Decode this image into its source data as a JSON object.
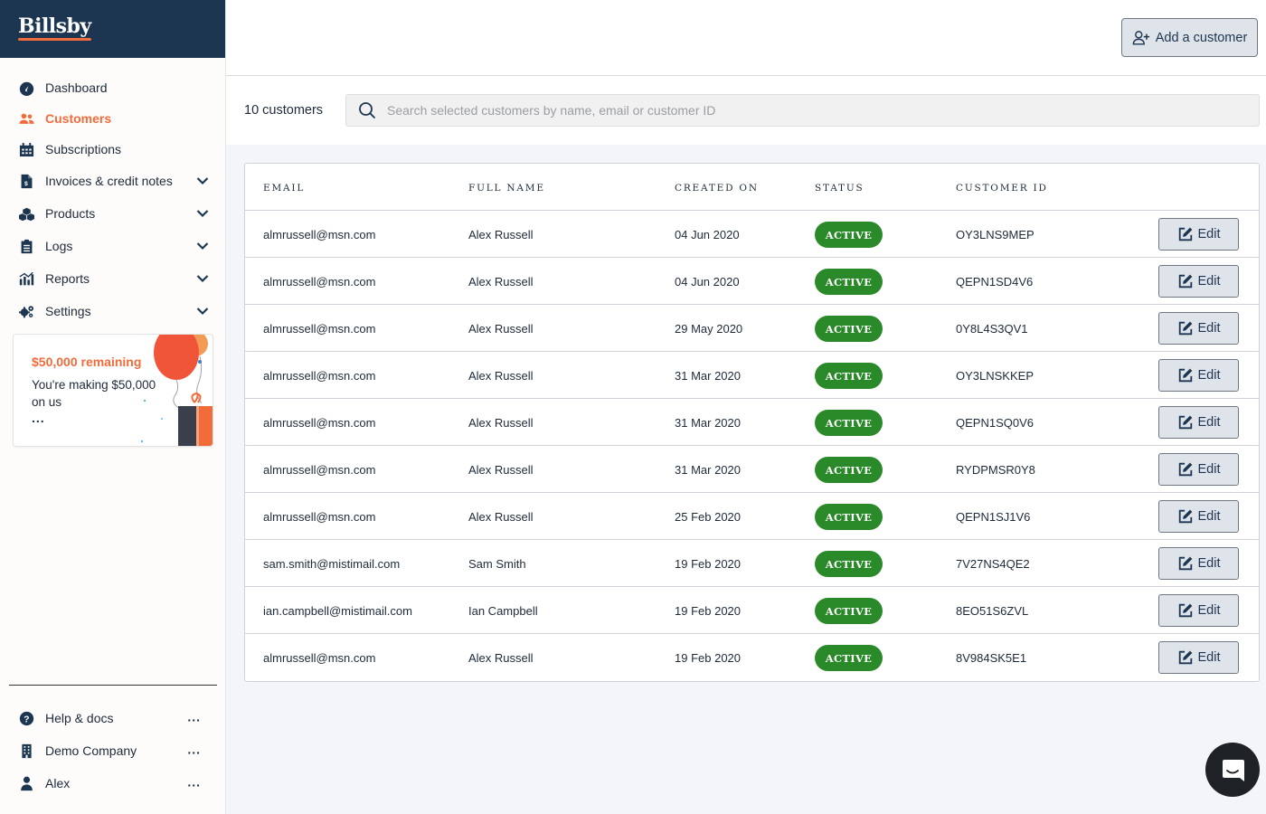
{
  "brand": {
    "name": "Billsby"
  },
  "sidebar": {
    "items": [
      {
        "label": "Dashboard",
        "icon": "dashboard-gauge-icon",
        "has_chevron": false,
        "active": false
      },
      {
        "label": "Customers",
        "icon": "users-icon",
        "has_chevron": false,
        "active": true
      },
      {
        "label": "Subscriptions",
        "icon": "calendar-icon",
        "has_chevron": false,
        "active": false
      },
      {
        "label": "Invoices & credit notes",
        "icon": "invoice-icon",
        "has_chevron": true,
        "active": false
      },
      {
        "label": "Products",
        "icon": "boxes-icon",
        "has_chevron": true,
        "active": false
      },
      {
        "label": "Logs",
        "icon": "clipboard-icon",
        "has_chevron": true,
        "active": false
      },
      {
        "label": "Reports",
        "icon": "chart-icon",
        "has_chevron": true,
        "active": false
      },
      {
        "label": "Settings",
        "icon": "gears-icon",
        "has_chevron": true,
        "active": false
      }
    ],
    "promo": {
      "title": "$50,000 remaining",
      "text": "You're making $50,000 on us",
      "more": "..."
    },
    "bottom": [
      {
        "label": "Help & docs",
        "icon": "question-circle-icon",
        "more": "..."
      },
      {
        "label": "Demo Company",
        "icon": "building-icon",
        "more": "..."
      },
      {
        "label": "Alex",
        "icon": "user-icon",
        "more": "..."
      }
    ]
  },
  "header": {
    "add_button_label": "Add a customer"
  },
  "search": {
    "count_label": "10 customers",
    "placeholder": "Search selected customers by name, email or customer ID"
  },
  "table": {
    "columns": [
      "EMAIL",
      "FULL NAME",
      "CREATED ON",
      "STATUS",
      "CUSTOMER ID"
    ],
    "edit_label": "Edit",
    "rows": [
      {
        "email": "almrussell@msn.com",
        "name": "Alex Russell",
        "created": "04 Jun 2020",
        "status": "ACTIVE",
        "id": "OY3LNS9MEP"
      },
      {
        "email": "almrussell@msn.com",
        "name": "Alex Russell",
        "created": "04 Jun 2020",
        "status": "ACTIVE",
        "id": "QEPN1SD4V6"
      },
      {
        "email": "almrussell@msn.com",
        "name": "Alex Russell",
        "created": "29 May 2020",
        "status": "ACTIVE",
        "id": "0Y8L4S3QV1"
      },
      {
        "email": "almrussell@msn.com",
        "name": "Alex Russell",
        "created": "31 Mar 2020",
        "status": "ACTIVE",
        "id": "OY3LNSKKEP"
      },
      {
        "email": "almrussell@msn.com",
        "name": "Alex Russell",
        "created": "31 Mar 2020",
        "status": "ACTIVE",
        "id": "QEPN1SQ0V6"
      },
      {
        "email": "almrussell@msn.com",
        "name": "Alex Russell",
        "created": "31 Mar 2020",
        "status": "ACTIVE",
        "id": "RYDPMSR0Y8"
      },
      {
        "email": "almrussell@msn.com",
        "name": "Alex Russell",
        "created": "25 Feb 2020",
        "status": "ACTIVE",
        "id": "QEPN1SJ1V6"
      },
      {
        "email": "sam.smith@mistimail.com",
        "name": "Sam Smith",
        "created": "19 Feb 2020",
        "status": "ACTIVE",
        "id": "7V27NS4QE2"
      },
      {
        "email": "ian.campbell@mistimail.com",
        "name": "Ian Campbell",
        "created": "19 Feb 2020",
        "status": "ACTIVE",
        "id": "8EO51S6ZVL"
      },
      {
        "email": "almrussell@msn.com",
        "name": "Alex Russell",
        "created": "19 Feb 2020",
        "status": "ACTIVE",
        "id": "8V984SK5E1"
      }
    ]
  },
  "colors": {
    "brand_dark": "#1c3651",
    "accent": "#f26b3a",
    "active_green": "#2a8a2a"
  }
}
